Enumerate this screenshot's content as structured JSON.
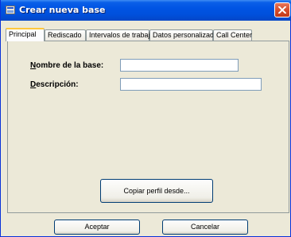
{
  "window": {
    "title": "Crear nueva base",
    "icon": "app-form-icon"
  },
  "tabs": [
    {
      "label": "Principal",
      "active": true
    },
    {
      "label": "Rediscado",
      "active": false
    },
    {
      "label": "Intervalos de trabajo",
      "active": false
    },
    {
      "label": "Datos personalizados",
      "active": false
    },
    {
      "label": "Call Center",
      "active": false
    }
  ],
  "form": {
    "nombre_label_acc": "N",
    "nombre_label_rest": "ombre de la base:",
    "nombre_value": "",
    "descripcion_label_acc": "D",
    "descripcion_label_rest": "escripción:",
    "descripcion_value": "",
    "copy_button": "Copiar perfil desde..."
  },
  "footer": {
    "accept": "Aceptar",
    "cancel": "Cancelar"
  },
  "colors": {
    "titlebar": "#0054e3",
    "window_bg": "#ece9d8",
    "active_tab_accent": "#ffc83c",
    "close_button": "#d64d2c"
  }
}
